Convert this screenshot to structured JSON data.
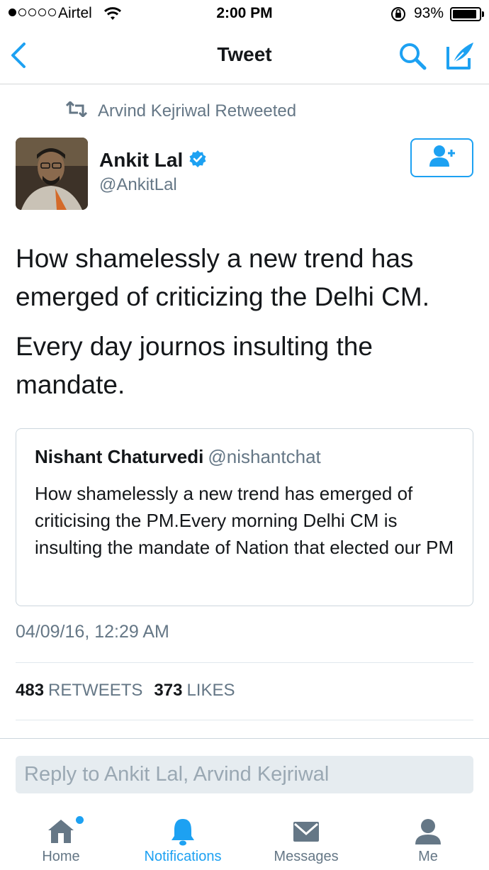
{
  "status_bar": {
    "carrier": "Airtel",
    "time": "2:00 PM",
    "battery_percent": "93%",
    "battery_level": 0.93,
    "signal_bars_filled": 1,
    "signal_bars_total": 5
  },
  "nav": {
    "title": "Tweet",
    "back_icon": "chevron-left-icon",
    "search_icon": "search-icon",
    "compose_icon": "compose-tweet-icon"
  },
  "retweet_context": {
    "label": "Arvind Kejriwal Retweeted"
  },
  "tweet": {
    "author_name": "Ankit Lal",
    "author_handle": "@AnkitLal",
    "verified": true,
    "paragraphs": [
      "How shamelessly a new trend has emerged of criticizing the Delhi CM.",
      "Every day journos insulting the mandate."
    ],
    "timestamp": "04/09/16, 12:29 AM",
    "retweets_count": "483",
    "retweets_label": "RETWEETS",
    "likes_count": "373",
    "likes_label": "LIKES"
  },
  "quoted_tweet": {
    "author_name": "Nishant Chaturvedi",
    "author_handle": "@nishantchat",
    "text": "How shamelessly a new trend has emerged of criticising the PM.Every morning Delhi CM is insulting the mandate of Nation that elected our PM"
  },
  "reply": {
    "placeholder": "Reply to Ankit Lal, Arvind Kejriwal"
  },
  "tabbar": {
    "tabs": [
      {
        "label": "Home",
        "icon": "home-icon",
        "active": false,
        "has_dot": true
      },
      {
        "label": "Notifications",
        "icon": "bell-icon",
        "active": true,
        "has_dot": false
      },
      {
        "label": "Messages",
        "icon": "envelope-icon",
        "active": false,
        "has_dot": false
      },
      {
        "label": "Me",
        "icon": "person-icon",
        "active": false,
        "has_dot": false
      }
    ]
  },
  "colors": {
    "accent": "#1da1f2",
    "secondary_text": "#657786",
    "primary_text": "#14171a",
    "border": "#ccd6dd"
  }
}
